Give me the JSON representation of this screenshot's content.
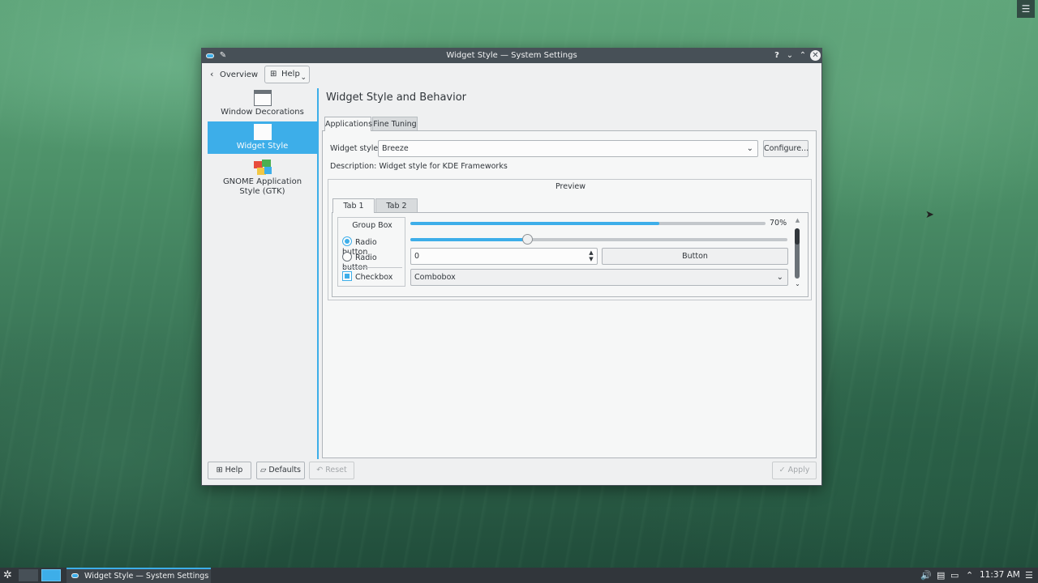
{
  "window": {
    "title": "Widget Style — System Settings",
    "title_buttons": {
      "help": "?",
      "minimize": "⌄",
      "maximize": "⌃",
      "close": "✕"
    }
  },
  "toolbar": {
    "overview_label": "Overview",
    "help_label": "Help"
  },
  "sidebar": {
    "items": [
      {
        "label": "Window Decorations",
        "icon": "window-decorations-icon",
        "selected": false
      },
      {
        "label": "Widget Style",
        "icon": "widget-style-icon",
        "selected": true
      },
      {
        "label": "GNOME Application Style (GTK)",
        "icon": "gtk-icon",
        "selected": false
      }
    ]
  },
  "content": {
    "page_title": "Widget Style and Behavior",
    "tabs": [
      {
        "label": "Applications",
        "active": true
      },
      {
        "label": "Fine Tuning",
        "active": false
      }
    ],
    "widget_style_label": "Widget style:",
    "widget_style_value": "Breeze",
    "configure_label": "Configure...",
    "description": "Description: Widget style for KDE Frameworks",
    "preview": {
      "title": "Preview",
      "tabs": [
        {
          "label": "Tab 1",
          "active": true
        },
        {
          "label": "Tab 2",
          "active": false
        }
      ],
      "group_box_title": "Group Box",
      "radio1_label": "Radio button",
      "radio2_label": "Radio button",
      "checkbox_label": "Checkbox",
      "progress_percent": 70,
      "progress_label": "70%",
      "slider_fraction": 0.31,
      "spinbox_value": "0",
      "button_label": "Button",
      "combobox_value": "Combobox"
    }
  },
  "footer": {
    "help_label": "Help",
    "defaults_label": "Defaults",
    "reset_label": "Reset",
    "apply_label": "Apply"
  },
  "taskbar": {
    "task_label": "Widget Style — System Settings",
    "clock": "11:37 AM"
  },
  "colors": {
    "accent": "#3daee9",
    "titlebar": "#475057",
    "window_bg": "#eff0f1",
    "taskbar": "#31363b"
  }
}
